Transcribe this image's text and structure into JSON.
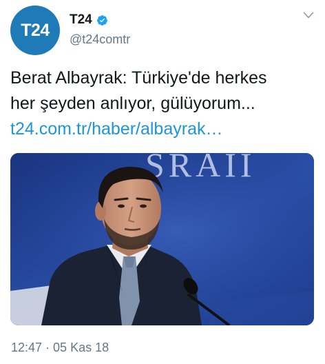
{
  "account": {
    "avatar_text": "T24",
    "display_name": "T24",
    "handle": "@t24comtr",
    "verified": true,
    "avatar_color": "#1f7ab8"
  },
  "menu": {
    "icon": "chevron-down-icon"
  },
  "tweet": {
    "text_line1": "Berat Albayrak: Türkiye'de herkes",
    "text_line2": "her şeyden anlıyor, gülüyorum...",
    "link": "t24.com.tr/haber/albayrak…",
    "link_color": "#1b95e0"
  },
  "media": {
    "backdrop_text": "SRAII"
  },
  "meta": {
    "timestamp": "12:47 · 05 Kas 18"
  }
}
